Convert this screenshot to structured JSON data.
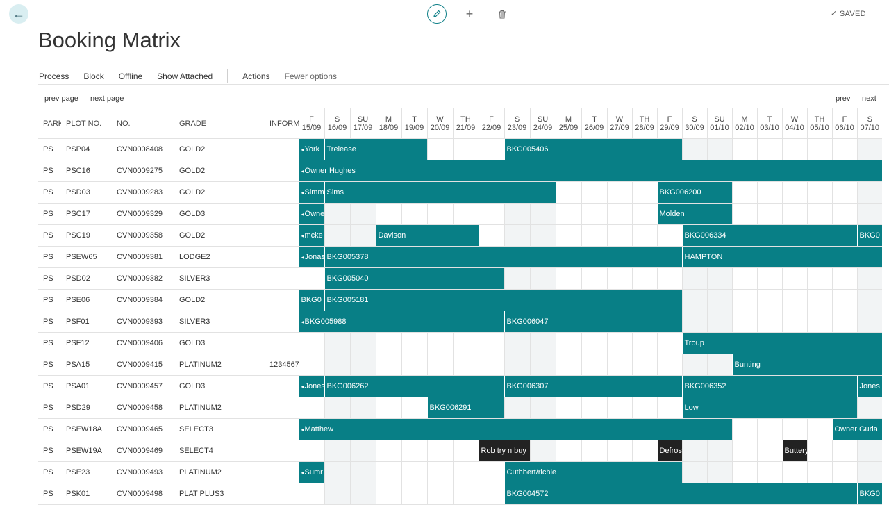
{
  "top": {
    "saved_label": "SAVED",
    "icons": [
      "back-arrow-icon",
      "edit-pencil-icon",
      "add-plus-icon",
      "delete-trash-icon",
      "check-icon"
    ]
  },
  "title": "Booking Matrix",
  "actions": [
    "Process",
    "Block",
    "Offline",
    "Show Attached",
    "Actions",
    "Fewer options"
  ],
  "pager": {
    "prev_page": "prev page",
    "next_page": "next page",
    "prev": "prev",
    "next": "next"
  },
  "columns": {
    "park": "PARK",
    "plot": "PLOT NO.",
    "no": "NO.",
    "grade": "GRADE",
    "inform": "INFORM"
  },
  "days": [
    {
      "d": "F",
      "date": "15/09"
    },
    {
      "d": "S",
      "date": "16/09"
    },
    {
      "d": "SU",
      "date": "17/09"
    },
    {
      "d": "M",
      "date": "18/09"
    },
    {
      "d": "T",
      "date": "19/09"
    },
    {
      "d": "W",
      "date": "20/09"
    },
    {
      "d": "TH",
      "date": "21/09"
    },
    {
      "d": "F",
      "date": "22/09"
    },
    {
      "d": "S",
      "date": "23/09"
    },
    {
      "d": "SU",
      "date": "24/09"
    },
    {
      "d": "M",
      "date": "25/09"
    },
    {
      "d": "T",
      "date": "26/09"
    },
    {
      "d": "W",
      "date": "27/09"
    },
    {
      "d": "TH",
      "date": "28/09"
    },
    {
      "d": "F",
      "date": "29/09"
    },
    {
      "d": "S",
      "date": "30/09"
    },
    {
      "d": "SU",
      "date": "01/10"
    },
    {
      "d": "M",
      "date": "02/10"
    },
    {
      "d": "T",
      "date": "03/10"
    },
    {
      "d": "W",
      "date": "04/10"
    },
    {
      "d": "TH",
      "date": "05/10"
    },
    {
      "d": "F",
      "date": "06/10"
    },
    {
      "d": "S",
      "date": "07/10"
    }
  ],
  "weekend_days": [
    1,
    2,
    8,
    9,
    15,
    16,
    22
  ],
  "colors": {
    "booking": "#087f86",
    "booking_dark": "#222222",
    "weekend": "#f2f4f5",
    "accent": "#0e7f87"
  },
  "rows": [
    {
      "park": "PS",
      "plot": "PSP04",
      "no": "CVN0008408",
      "grade": "GOLD2",
      "inform": "",
      "bookings": [
        {
          "s": 0,
          "e": 0,
          "label": "York",
          "arrow": true
        },
        {
          "s": 1,
          "e": 4,
          "label": "Trelease"
        },
        {
          "s": 8,
          "e": 14,
          "label": "BKG005406"
        }
      ]
    },
    {
      "park": "PS",
      "plot": "PSC16",
      "no": "CVN0009275",
      "grade": "GOLD2",
      "inform": "",
      "bookings": [
        {
          "s": 0,
          "e": 22,
          "label": "Owner Hughes",
          "arrow": true
        }
      ]
    },
    {
      "park": "PS",
      "plot": "PSD03",
      "no": "CVN0009283",
      "grade": "GOLD2",
      "inform": "",
      "bookings": [
        {
          "s": 0,
          "e": 0,
          "label": "Simm",
          "arrow": true
        },
        {
          "s": 1,
          "e": 9,
          "label": "Sims"
        },
        {
          "s": 14,
          "e": 16,
          "label": "BKG006200"
        }
      ]
    },
    {
      "park": "PS",
      "plot": "PSC17",
      "no": "CVN0009329",
      "grade": "GOLD3",
      "inform": "",
      "bookings": [
        {
          "s": 0,
          "e": 0,
          "label": "Owne",
          "arrow": true
        },
        {
          "s": 14,
          "e": 16,
          "label": "Molden"
        }
      ]
    },
    {
      "park": "PS",
      "plot": "PSC19",
      "no": "CVN0009358",
      "grade": "GOLD2",
      "inform": "",
      "bookings": [
        {
          "s": 0,
          "e": 0,
          "label": "mcke",
          "arrow": true
        },
        {
          "s": 3,
          "e": 6,
          "label": "Davison"
        },
        {
          "s": 15,
          "e": 21,
          "label": "BKG006334"
        },
        {
          "s": 22,
          "e": 22,
          "label": "BKG0"
        }
      ]
    },
    {
      "park": "PS",
      "plot": "PSEW65",
      "no": "CVN0009381",
      "grade": "LODGE2",
      "inform": "",
      "bookings": [
        {
          "s": 0,
          "e": 0,
          "label": "Jonas",
          "arrow": true
        },
        {
          "s": 1,
          "e": 14,
          "label": "BKG005378"
        },
        {
          "s": 15,
          "e": 22,
          "label": "HAMPTON"
        }
      ]
    },
    {
      "park": "PS",
      "plot": "PSD02",
      "no": "CVN0009382",
      "grade": "SILVER3",
      "inform": "",
      "bookings": [
        {
          "s": 1,
          "e": 7,
          "label": "BKG005040"
        }
      ]
    },
    {
      "park": "PS",
      "plot": "PSE06",
      "no": "CVN0009384",
      "grade": "GOLD2",
      "inform": "",
      "bookings": [
        {
          "s": 0,
          "e": 0,
          "label": "BKG0"
        },
        {
          "s": 1,
          "e": 14,
          "label": "BKG005181"
        }
      ]
    },
    {
      "park": "PS",
      "plot": "PSF01",
      "no": "CVN0009393",
      "grade": "SILVER3",
      "inform": "",
      "bookings": [
        {
          "s": 0,
          "e": 7,
          "label": "BKG005988",
          "arrow": true
        },
        {
          "s": 8,
          "e": 14,
          "label": "BKG006047"
        }
      ]
    },
    {
      "park": "PS",
      "plot": "PSF12",
      "no": "CVN0009406",
      "grade": "GOLD3",
      "inform": "",
      "bookings": [
        {
          "s": 15,
          "e": 22,
          "label": "Troup"
        }
      ]
    },
    {
      "park": "PS",
      "plot": "PSA15",
      "no": "CVN0009415",
      "grade": "PLATINUM2",
      "inform": "1234567",
      "bookings": [
        {
          "s": 17,
          "e": 22,
          "label": "Bunting"
        }
      ]
    },
    {
      "park": "PS",
      "plot": "PSA01",
      "no": "CVN0009457",
      "grade": "GOLD3",
      "inform": "",
      "bookings": [
        {
          "s": 0,
          "e": 0,
          "label": "Jones",
          "arrow": true
        },
        {
          "s": 1,
          "e": 7,
          "label": "BKG006262"
        },
        {
          "s": 8,
          "e": 14,
          "label": "BKG006307"
        },
        {
          "s": 15,
          "e": 21,
          "label": "BKG006352"
        },
        {
          "s": 22,
          "e": 22,
          "label": "Jones"
        }
      ]
    },
    {
      "park": "PS",
      "plot": "PSD29",
      "no": "CVN0009458",
      "grade": "PLATINUM2",
      "inform": "",
      "bookings": [
        {
          "s": 5,
          "e": 7,
          "label": "BKG006291"
        },
        {
          "s": 15,
          "e": 21,
          "label": "Low"
        }
      ]
    },
    {
      "park": "PS",
      "plot": "PSEW18A",
      "no": "CVN0009465",
      "grade": "SELECT3",
      "inform": "",
      "bookings": [
        {
          "s": 0,
          "e": 16,
          "label": "Matthew",
          "arrow": true
        },
        {
          "s": 21,
          "e": 22,
          "label": "Owner Guria"
        }
      ]
    },
    {
      "park": "PS",
      "plot": "PSEW19A",
      "no": "CVN0009469",
      "grade": "SELECT4",
      "inform": "",
      "bookings": [
        {
          "s": 7,
          "e": 8,
          "label": "Rob try n buy",
          "dark": true
        },
        {
          "s": 14,
          "e": 14,
          "label": "Defros",
          "dark": true
        },
        {
          "s": 19,
          "e": 19,
          "label": "Buttery",
          "dark": true
        }
      ]
    },
    {
      "park": "PS",
      "plot": "PSE23",
      "no": "CVN0009493",
      "grade": "PLATINUM2",
      "inform": "",
      "bookings": [
        {
          "s": 0,
          "e": 0,
          "label": "Sumr",
          "arrow": true
        },
        {
          "s": 8,
          "e": 14,
          "label": "Cuthbert/richie"
        }
      ]
    },
    {
      "park": "PS",
      "plot": "PSK01",
      "no": "CVN0009498",
      "grade": "PLAT PLUS3",
      "inform": "",
      "bookings": [
        {
          "s": 8,
          "e": 21,
          "label": "BKG004572"
        },
        {
          "s": 22,
          "e": 22,
          "label": "BKG0"
        }
      ]
    }
  ]
}
